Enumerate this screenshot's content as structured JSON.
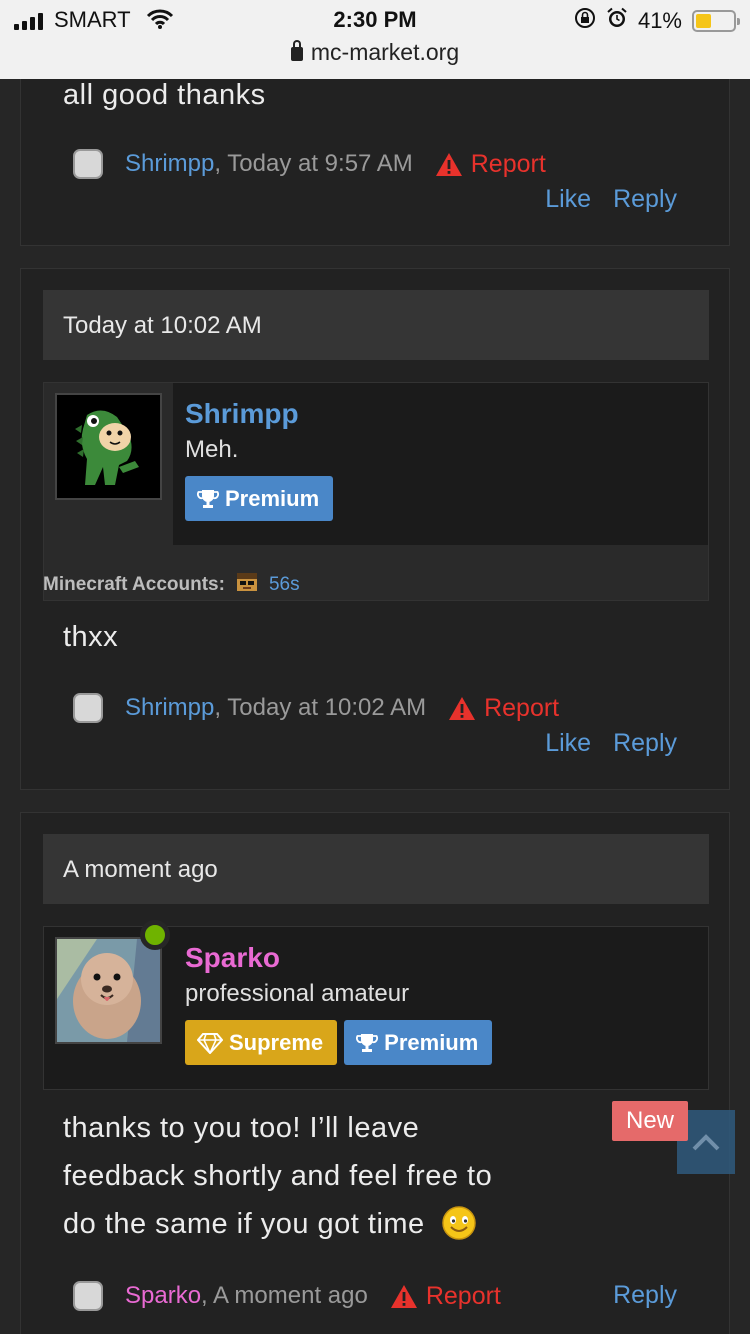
{
  "status_bar": {
    "carrier": "SMART",
    "time": "2:30 PM",
    "battery": "41%",
    "battery_level": 0.41,
    "url": "mc-market.org"
  },
  "post0": {
    "message": "all good thanks",
    "author": "Shrimpp",
    "timestamp": ", Today at 9:57 AM",
    "report": "Report",
    "like": "Like",
    "reply": "Reply"
  },
  "post1": {
    "date": "Today at 10:02 AM",
    "username": "Shrimpp",
    "usertitle": "Meh.",
    "badge_premium": "Premium",
    "accounts_label": "Minecraft Accounts:",
    "accounts_value": "56s",
    "message": "thxx",
    "author": "Shrimpp",
    "timestamp": ", Today at 10:02 AM",
    "report": "Report",
    "like": "Like",
    "reply": "Reply"
  },
  "post2": {
    "date": "A moment ago",
    "username": "Sparko",
    "usertitle": "professional amateur",
    "badge_supreme": "Supreme",
    "badge_premium": "Premium",
    "message_line1": "thanks to you too! I’ll leave",
    "message_line2": "feedback shortly and feel free to",
    "message_line3": "do the same if you got time",
    "new_label": "New",
    "author": "Sparko",
    "timestamp": ", A moment ago",
    "report": "Report",
    "reply": "Reply"
  },
  "colors": {
    "link_blue": "#5b9bd9",
    "username_pink": "#e96ad3",
    "report_red": "#e8322c",
    "premium_blue": "#4a87c8",
    "supreme_gold": "#d9a61a",
    "online_green": "#6fb300"
  }
}
